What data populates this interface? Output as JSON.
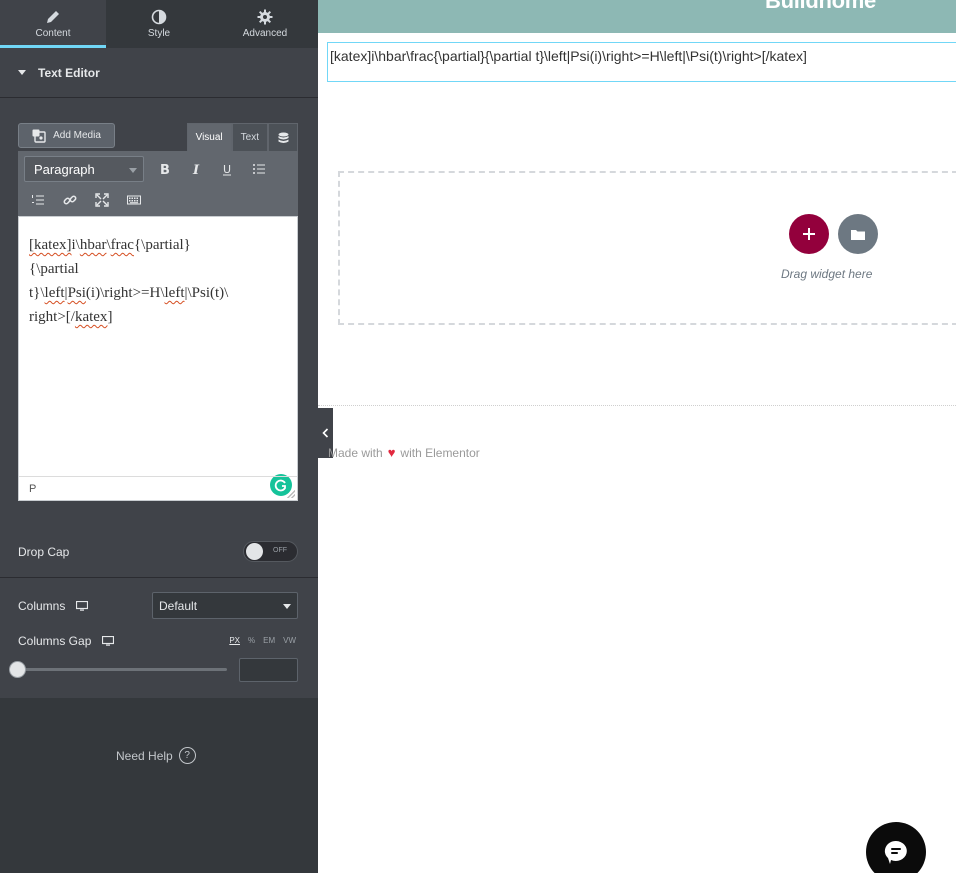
{
  "panel": {
    "tabs": [
      {
        "label": "Content",
        "icon": "pencil-icon",
        "active": true
      },
      {
        "label": "Style",
        "icon": "half-circle-icon",
        "active": false
      },
      {
        "label": "Advanced",
        "icon": "gear-icon",
        "active": false
      }
    ],
    "section_title": "Text Editor",
    "add_media_label": "Add Media",
    "mode_tabs": {
      "visual": "Visual",
      "text": "Text"
    },
    "format_select": "Paragraph",
    "editor": {
      "line1_a": "[katex]",
      "line1_b": "i\\",
      "line1_c": "hbar",
      "line1_d": "\\",
      "line1_e": "frac",
      "line1_f": "{\\partial}",
      "line2": "{\\partial",
      "line3_a": "t}\\",
      "line3_b": "left",
      "line3_c": "|",
      "line3_d": "Psi",
      "line3_e": "(i)\\right>=H\\",
      "line3_f": "left",
      "line3_g": "|\\Psi(t)\\",
      "line4_a": "right>[/",
      "line4_b": "katex",
      "line4_c": "]",
      "status": "P"
    },
    "drop_cap_label": "Drop Cap",
    "drop_cap_toggle": "OFF",
    "columns_label": "Columns",
    "columns_value": "Default",
    "columns_gap_label": "Columns Gap",
    "units": [
      "PX",
      "%",
      "EM",
      "VW"
    ],
    "active_unit": "PX",
    "gap_value": "",
    "need_help": "Need Help"
  },
  "preview": {
    "logo": "Buildhome",
    "widget_text": "[katex]i\\hbar\\frac{\\partial}{\\partial t}\\left|Psi(i)\\right>=H\\left|\\Psi(t)\\right>[/katex]",
    "drag_hint": "Drag widget here",
    "footer_prefix": "Made with",
    "footer_suffix": "with Elementor"
  },
  "colors": {
    "panel_bg": "#404349",
    "accent_tab": "#71d7f7",
    "header_bg": "#8db8b4",
    "add_button": "#93003c",
    "template_button": "#6d7882"
  }
}
